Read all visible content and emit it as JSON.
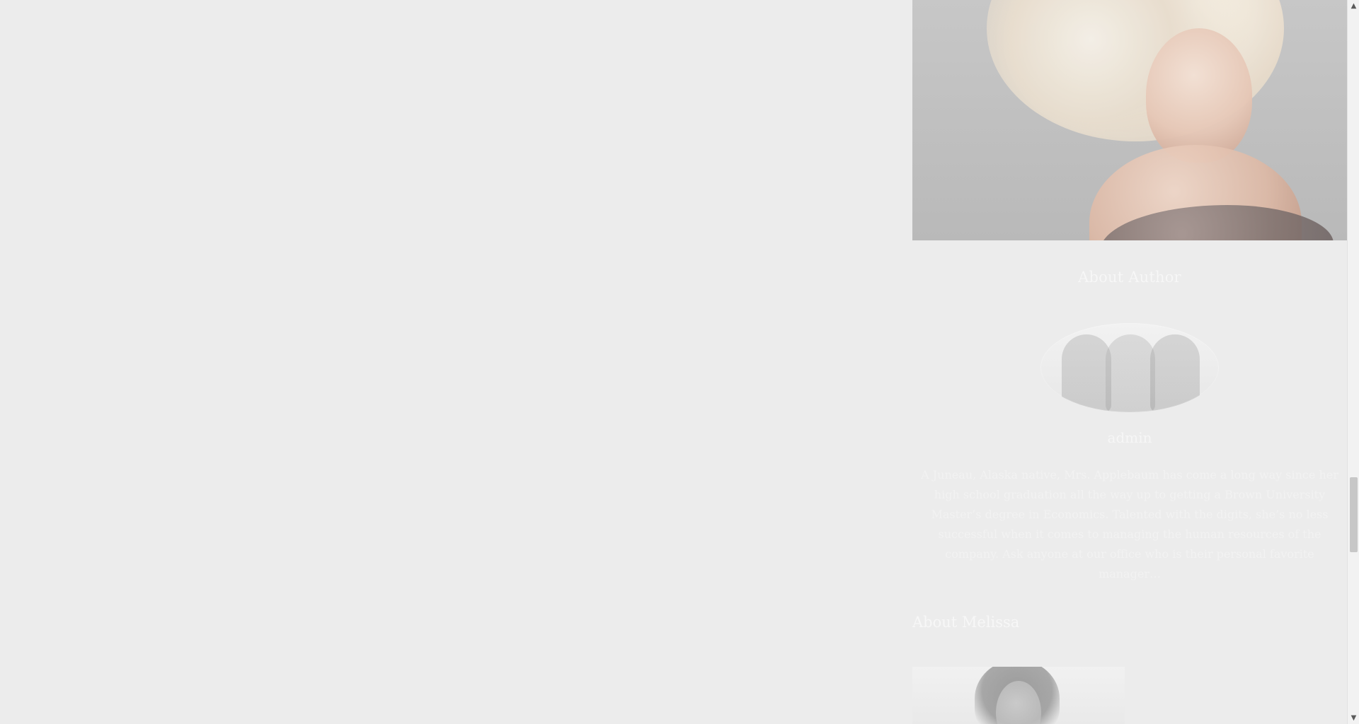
{
  "sidebar": {
    "about_author": {
      "title": "About Author",
      "author_name": "admin",
      "bio": "A Juneau, Alaska native, Mrs. Applebaum has come a long way since her high school graduation all the way up to getting a Brown University Master’s degree in Economics. Talented with the digits, she’s no less successful when it comes to managing the human resources of the company. Ask anyone at our office who is their personal favorite manager…"
    },
    "about_melissa": {
      "title": "About Melissa"
    }
  },
  "scrollbar": {
    "up_arrow": "▲",
    "down_arrow": "▼",
    "position": 0.66
  },
  "icons": {
    "scroll_up": "scroll-up-icon",
    "scroll_down": "scroll-down-icon"
  }
}
